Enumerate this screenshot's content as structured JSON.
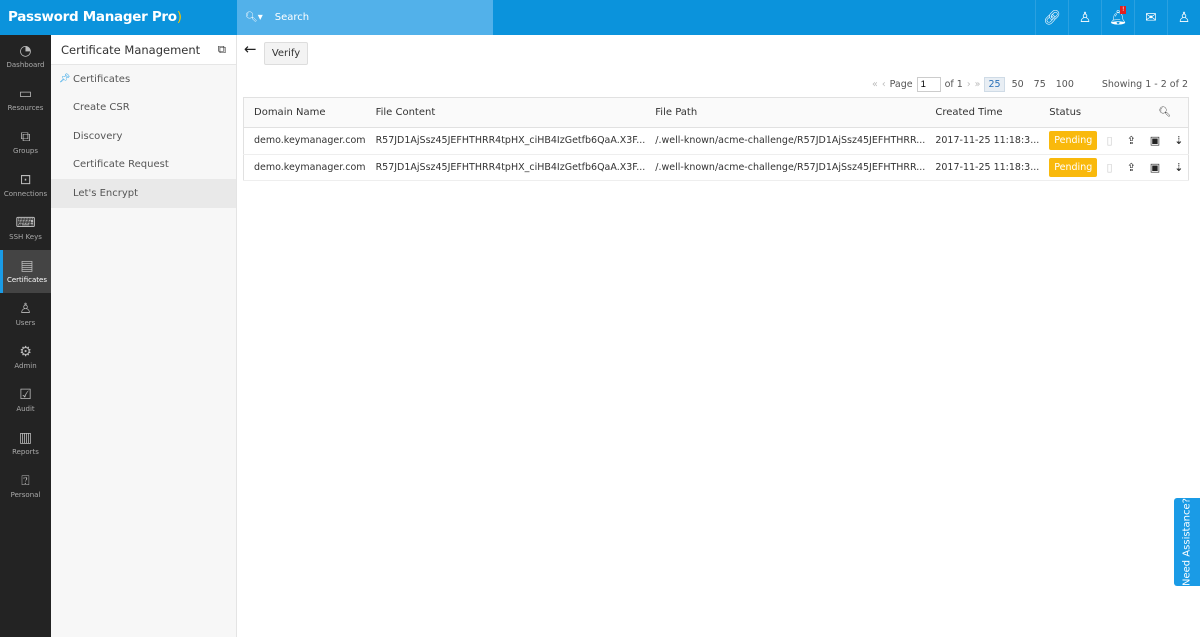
{
  "app": {
    "title": "Password Manager Pro"
  },
  "search": {
    "placeholder": "Search"
  },
  "topbar": {
    "notification_count": "!"
  },
  "rail": [
    {
      "label": "Dashboard",
      "icon": "◔"
    },
    {
      "label": "Resources",
      "icon": "▭"
    },
    {
      "label": "Groups",
      "icon": "⧉"
    },
    {
      "label": "Connections",
      "icon": "⊡"
    },
    {
      "label": "SSH Keys",
      "icon": "⌨"
    },
    {
      "label": "Certificates",
      "icon": "▤"
    },
    {
      "label": "Users",
      "icon": "♙"
    },
    {
      "label": "Admin",
      "icon": "⚙"
    },
    {
      "label": "Audit",
      "icon": "☑"
    },
    {
      "label": "Reports",
      "icon": "▥"
    },
    {
      "label": "Personal",
      "icon": "⍰"
    }
  ],
  "submenu": {
    "title": "Certificate Management",
    "items": [
      "Certificates",
      "Create CSR",
      "Discovery",
      "Certificate Request",
      "Let's Encrypt"
    ]
  },
  "toolbar": {
    "verify": "Verify"
  },
  "pager": {
    "page_label": "Page",
    "page": "1",
    "of": "of 1",
    "sizes": [
      "25",
      "50",
      "75",
      "100"
    ],
    "showing": "Showing 1 - 2 of 2"
  },
  "table": {
    "headers": [
      "Domain Name",
      "File Content",
      "File Path",
      "Created Time",
      "Status"
    ],
    "rows": [
      {
        "domain": "demo.keymanager.com",
        "content": "R57JD1AjSsz45JEFHTHRR4tpHX_ciHB4IzGetfb6QaA.X3F...",
        "path": "/.well-known/acme-challenge/R57JD1AjSsz45JEFHTHRR...",
        "created": "2017-11-25 11:18:3...",
        "status": "Pending"
      },
      {
        "domain": "demo.keymanager.com",
        "content": "R57JD1AjSsz45JEFHTHRR4tpHX_ciHB4IzGetfb6QaA.X3F...",
        "path": "/.well-known/acme-challenge/R57JD1AjSsz45JEFHTHRR...",
        "created": "2017-11-25 11:18:3...",
        "status": "Pending"
      }
    ]
  },
  "assist": "Need Assistance?"
}
